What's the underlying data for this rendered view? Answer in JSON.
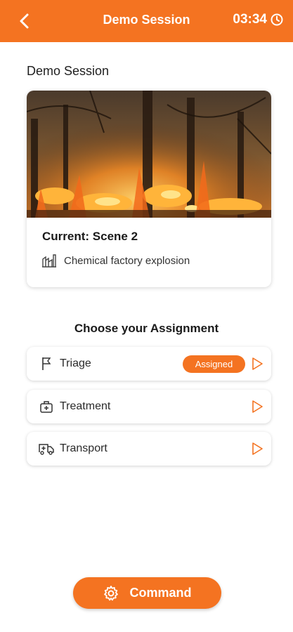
{
  "header": {
    "title": "Demo Session",
    "timer": "03:34",
    "back_icon": "chevron-left-icon",
    "timer_icon": "clock-icon"
  },
  "session": {
    "title": "Demo Session"
  },
  "scene": {
    "image": "forest-fire-photo",
    "current": "Current: Scene 2",
    "description": "Chemical factory explosion",
    "description_icon": "factory-icon"
  },
  "assignment": {
    "title": "Choose your Assignment",
    "items": [
      {
        "label": "Triage",
        "icon": "flag-icon",
        "badge": "Assigned",
        "action_icon": "play-icon"
      },
      {
        "label": "Treatment",
        "icon": "medical-kit-icon",
        "action_icon": "play-icon"
      },
      {
        "label": "Transport",
        "icon": "ambulance-icon",
        "action_icon": "play-icon"
      }
    ]
  },
  "command": {
    "label": "Command",
    "icon": "gear-icon"
  },
  "colors": {
    "accent": "#f47321",
    "background": "#ffffff",
    "text": "#1a1a1a"
  }
}
